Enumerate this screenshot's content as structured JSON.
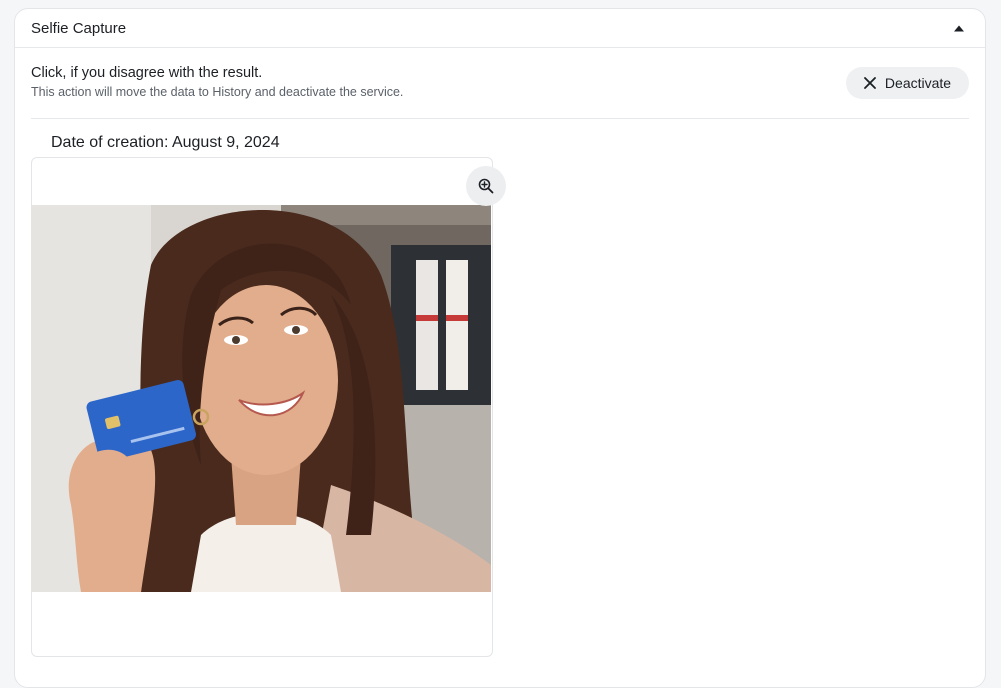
{
  "section": {
    "title": "Selfie Capture"
  },
  "notice": {
    "title": "Click, if you disagree with the result.",
    "subtitle": "This action will move the data to History and deactivate the service.",
    "deactivate_label": "Deactivate"
  },
  "capture": {
    "date_label": "Date of creation: August 9, 2024"
  },
  "icons": {
    "collapse": "caret-up-icon",
    "close": "close-icon",
    "zoom": "zoom-in-icon"
  }
}
